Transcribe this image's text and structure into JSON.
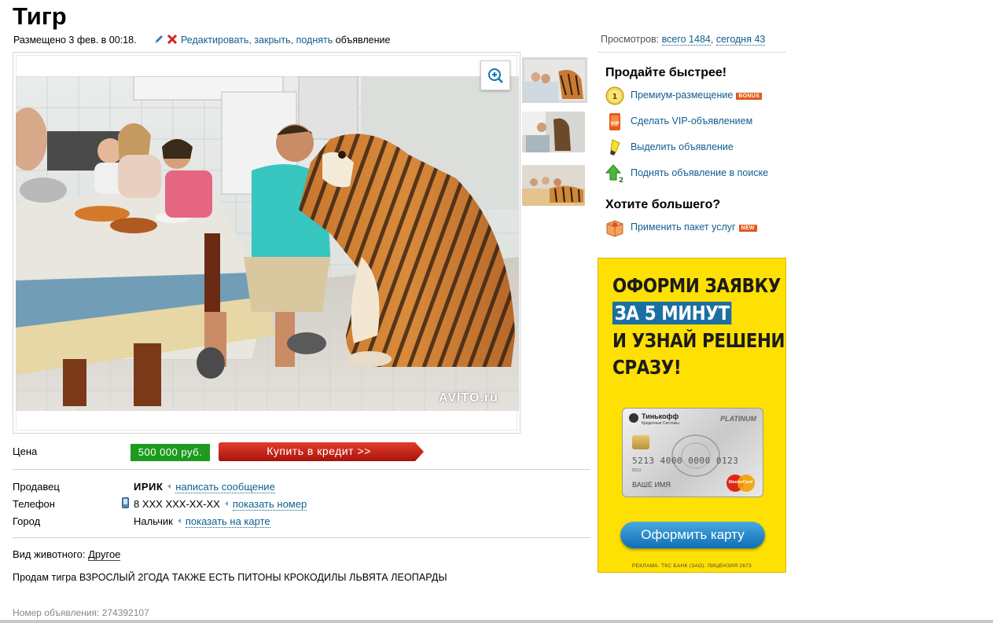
{
  "title": "Тигр",
  "posted": {
    "text": "Размещено 3 фев. в 00:18.",
    "edit_link": "Редактировать, закрыть, поднять",
    "edit_suffix": "объявление"
  },
  "views": {
    "label": "Просмотров:",
    "total": "всего 1484",
    "sep": ",",
    "today": "сегодня 43"
  },
  "photo": {
    "watermark": "AVITO.ru",
    "thumbnails_count": 3
  },
  "price": {
    "label": "Цена",
    "value": "500 000 руб.",
    "credit_button": "Купить в кредит >>"
  },
  "seller": {
    "label": "Продавец",
    "name": "ИРИК",
    "message_link": "написать сообщение"
  },
  "phone": {
    "label": "Телефон",
    "value": "8 XXX XXX-XX-XX",
    "show_link": "показать номер"
  },
  "city": {
    "label": "Город",
    "value": "Нальчик",
    "map_link": "показать на карте"
  },
  "animal": {
    "label": "Вид животного:",
    "value": "Другое"
  },
  "description": "Продам тигра ВЗРОСЛЫЙ 2ГОДА ТАКЖЕ ЕСТЬ ПИТОНЫ КРОКОДИЛЫ ЛЬВЯТА ЛЕОПАРДЫ",
  "ad_number": "Номер объявления: 274392107",
  "promo": {
    "heading1": "Продайте быстрее!",
    "items": [
      {
        "label": "Премиум-размещение",
        "tag": "BONUS",
        "icon": "coin-icon"
      },
      {
        "label": "Сделать VIP-объявлением",
        "icon": "vip-icon"
      },
      {
        "label": "Выделить объявление",
        "icon": "highlighter-icon"
      },
      {
        "label": "Поднять объявление в поиске",
        "icon": "up-arrow-icon"
      }
    ],
    "heading2": "Хотите большего?",
    "package": {
      "label": "Применить пакет услуг",
      "tag": "NEW",
      "icon": "package-icon"
    }
  },
  "banner": {
    "line1": "ОФОРМИ ЗАЯВКУ",
    "line2": "ЗА 5 МИНУТ",
    "line3": "И УЗНАЙ РЕШЕНИЕ",
    "line4": "СРАЗУ!",
    "card_bank": "Тинькофф",
    "card_bank_sub": "Кредитные Системы",
    "card_tier": "PLATINUM",
    "card_number": "5213 4000 0000 0123",
    "card_small": "5213",
    "card_holder": "ВАШЕ ИМЯ",
    "card_brand": "MasterCard",
    "button": "Оформить карту",
    "footer": "РЕКЛАМА. ТКС БАНК (ЗАО). ЛИЦЕНЗИЯ 2673",
    "colors": {
      "background": "#ffe003",
      "highlight": "#1c6fa2",
      "button": "#0e6fb5"
    }
  }
}
